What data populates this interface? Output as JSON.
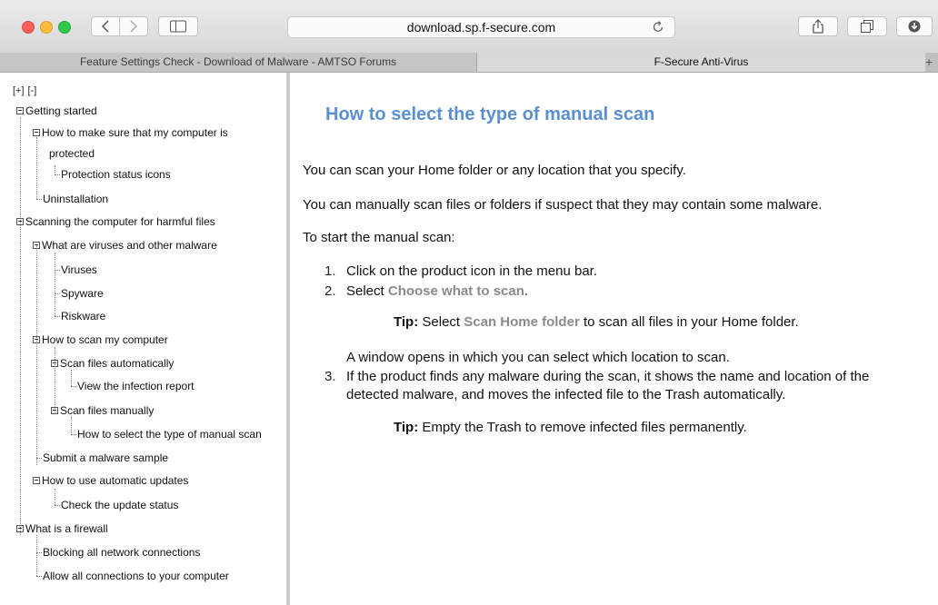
{
  "browser": {
    "url": "download.sp.f-secure.com",
    "tabs": [
      {
        "label": "Feature Settings Check - Download of Malware - AMTSO Forums"
      },
      {
        "label": "F-Secure Anti-Virus"
      }
    ],
    "new_tab_label": "+"
  },
  "sidebar": {
    "expand_all": "[+]",
    "collapse_all": "[-]",
    "items": [
      {
        "label": "Getting started"
      },
      {
        "label": "How to make sure that my computer is"
      },
      {
        "label": "protected"
      },
      {
        "label": "Protection status icons"
      },
      {
        "label": "Uninstallation"
      },
      {
        "label": "Scanning the computer for harmful files"
      },
      {
        "label": "What are viruses and other malware"
      },
      {
        "label": "Viruses"
      },
      {
        "label": "Spyware"
      },
      {
        "label": "Riskware"
      },
      {
        "label": "How to scan my computer"
      },
      {
        "label": "Scan files automatically"
      },
      {
        "label": "View the infection report"
      },
      {
        "label": "Scan files manually"
      },
      {
        "label": "How to select the type of manual scan"
      },
      {
        "label": "Submit a malware sample"
      },
      {
        "label": "How to use automatic updates"
      },
      {
        "label": "Check the update status"
      },
      {
        "label": "What is a firewall"
      },
      {
        "label": "Blocking all network connections"
      },
      {
        "label": "Allow all connections to your computer"
      }
    ]
  },
  "content": {
    "title": "How to select the type of manual scan",
    "p1": "You can scan your Home folder or any location that you specify.",
    "p2": "You can manually scan files or folders if suspect that they may contain some malware.",
    "p3": "To start the manual scan:",
    "steps": {
      "n1": "1.",
      "s1": "Click on the product icon in the menu bar.",
      "n2": "2.",
      "s2_prefix": "Select ",
      "s2_link": "Choose what to scan",
      "s2_suffix": ".",
      "tip1_label": "Tip:",
      "tip1_prefix": " Select ",
      "tip1_link": "Scan Home folder",
      "tip1_suffix": " to scan all files in your Home folder.",
      "window_text": "A window opens in which you can select which location to scan.",
      "n3": "3.",
      "s3_line1": "If the product finds any malware during the scan, it shows the name and location of the",
      "s3_line2": "detected malware, and moves the infected file to the Trash automatically.",
      "tip2_label": "Tip:",
      "tip2_text": " Empty the Trash to remove infected files permanently."
    }
  }
}
